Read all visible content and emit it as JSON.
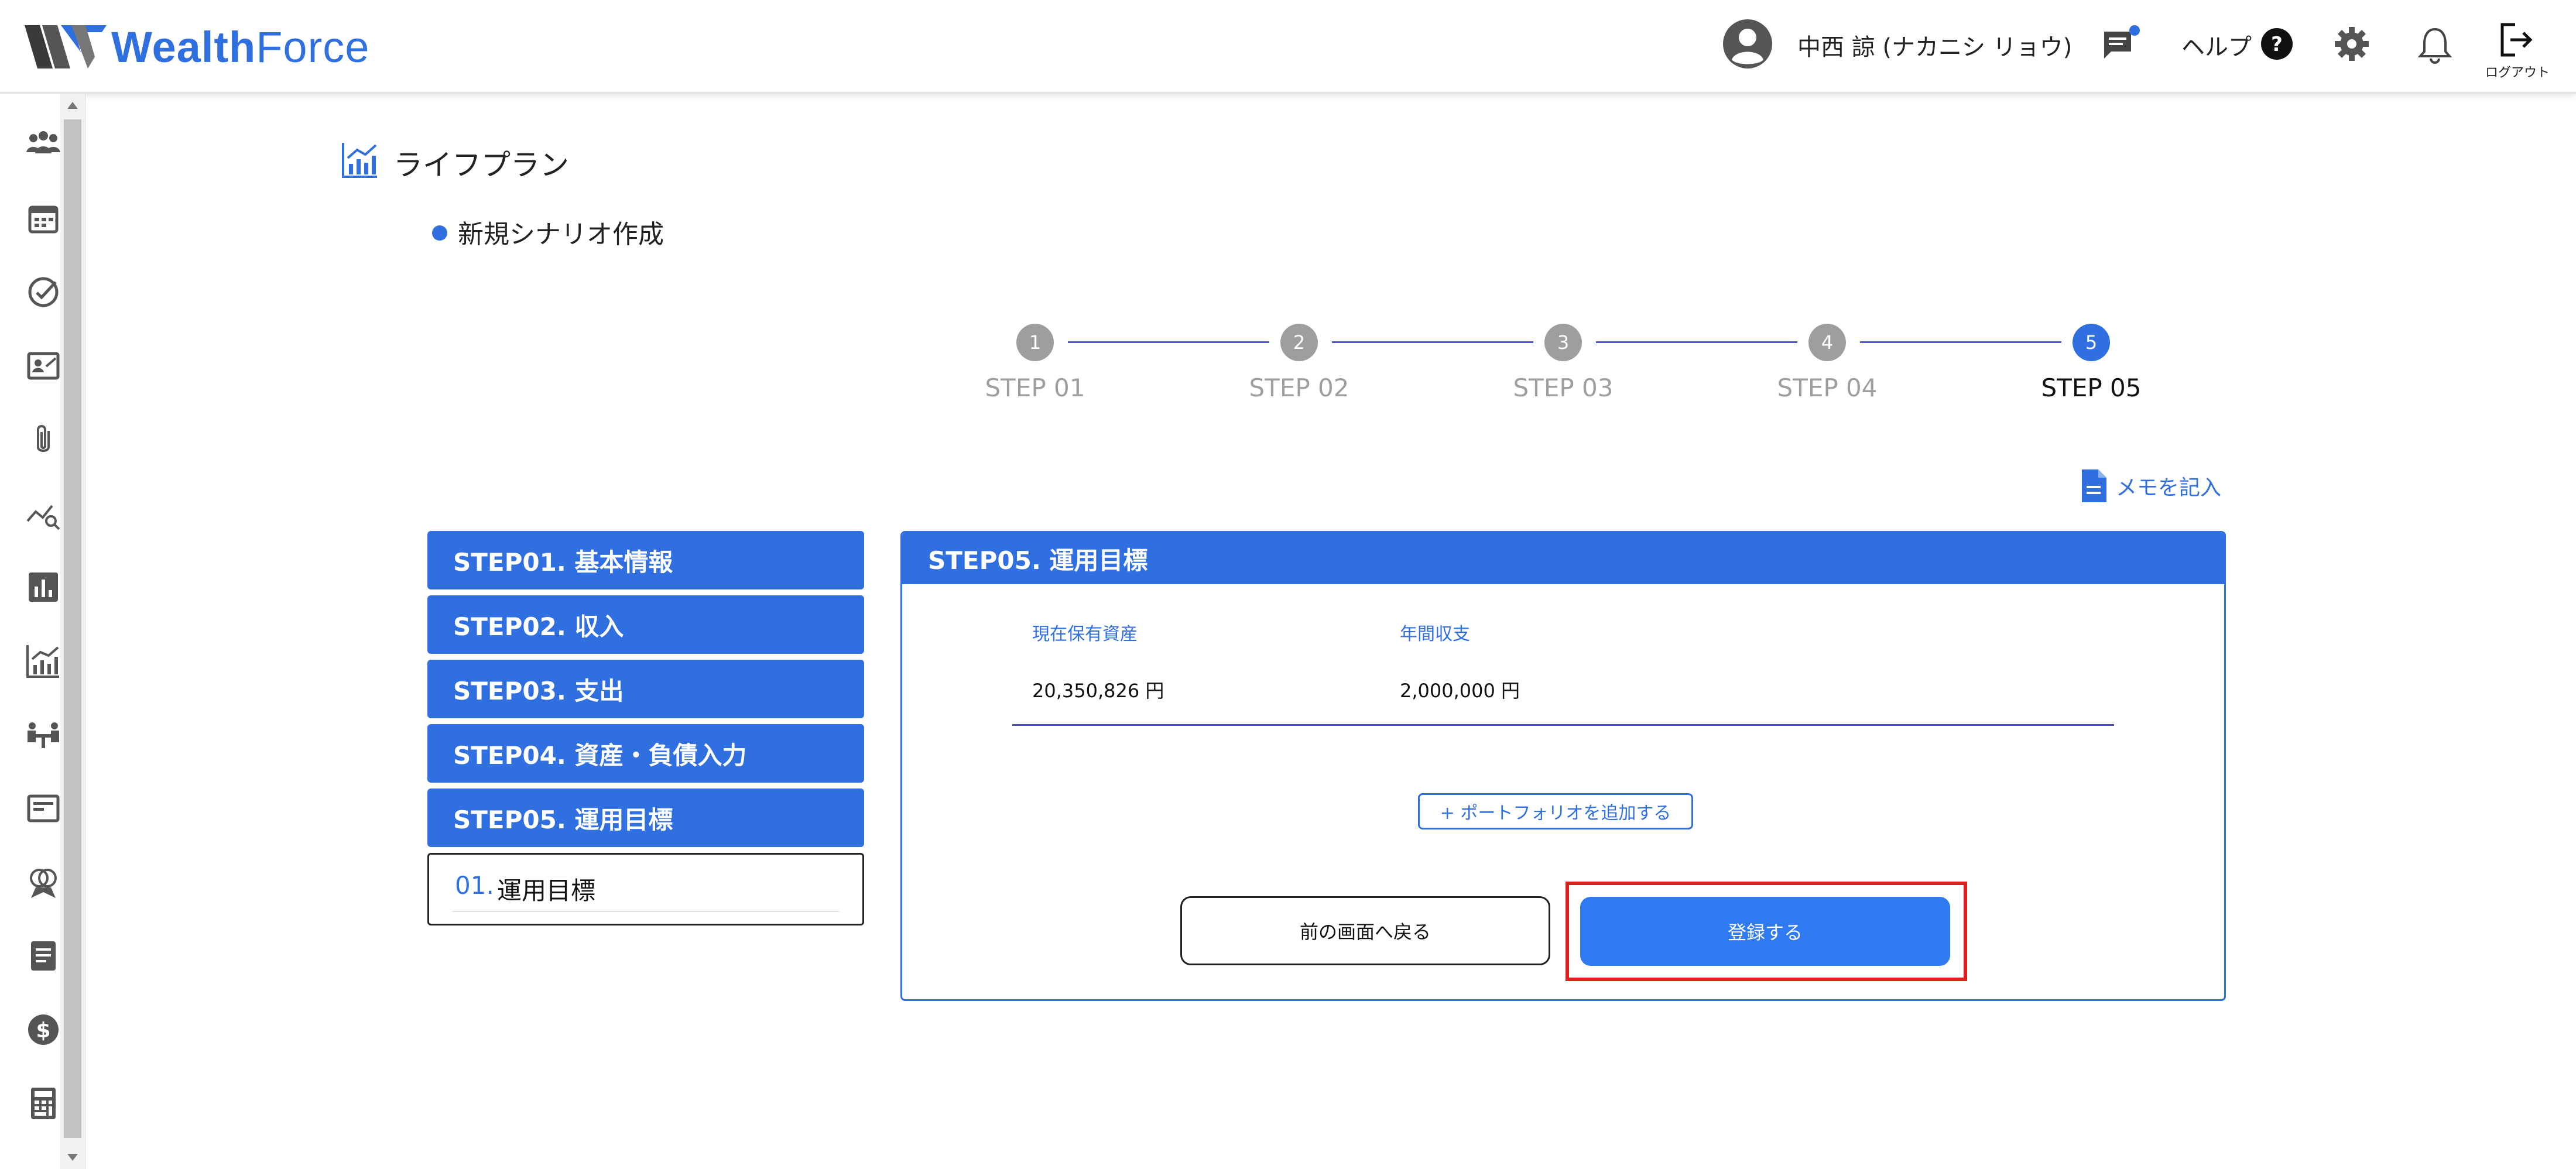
{
  "header": {
    "logo_text_bold": "Wealth",
    "logo_text_light": "Force",
    "username": "中西 諒 (ナカニシ リョウ)",
    "help_label": "ヘルプ",
    "logout_label": "ログアウト"
  },
  "sidebar": {
    "icons": [
      "customers-icon",
      "calendar-icon",
      "check-circle-icon",
      "contact-card-icon",
      "attachment-icon",
      "analysis-icon",
      "bar-chart-icon",
      "life-plan-chart-icon",
      "meeting-icon",
      "news-icon",
      "insurance-icon",
      "document-icon",
      "dollar-icon",
      "calculator-icon"
    ]
  },
  "page": {
    "title": "ライフプラン",
    "section_title": "新規シナリオ作成"
  },
  "stepper": {
    "steps": [
      {
        "number": "1",
        "label": "STEP 01",
        "active": false
      },
      {
        "number": "2",
        "label": "STEP 02",
        "active": false
      },
      {
        "number": "3",
        "label": "STEP 03",
        "active": false
      },
      {
        "number": "4",
        "label": "STEP 04",
        "active": false
      },
      {
        "number": "5",
        "label": "STEP 05",
        "active": true
      }
    ]
  },
  "memo_label": "メモを記入",
  "step_menu": {
    "items": [
      "STEP01. 基本情報",
      "STEP02. 収入",
      "STEP03. 支出",
      "STEP04. 資産・負債入力",
      "STEP05. 運用目標"
    ],
    "sub_number": "01.",
    "sub_label": "運用目標"
  },
  "panel": {
    "title": "STEP05. 運用目標",
    "current_assets_label": "現在保有資産",
    "annual_balance_label": "年間収支",
    "current_assets_value": "20,350,826 円",
    "annual_balance_value": "2,000,000 円",
    "add_portfolio_label": "+ ポートフォリオを追加する",
    "back_label": "前の画面へ戻る",
    "register_label": "登録する"
  },
  "colors": {
    "accent": "#2f6fe0",
    "highlight": "#e01e1e",
    "stepper_line": "#5557c9",
    "inactive_step": "#9e9e9e"
  }
}
